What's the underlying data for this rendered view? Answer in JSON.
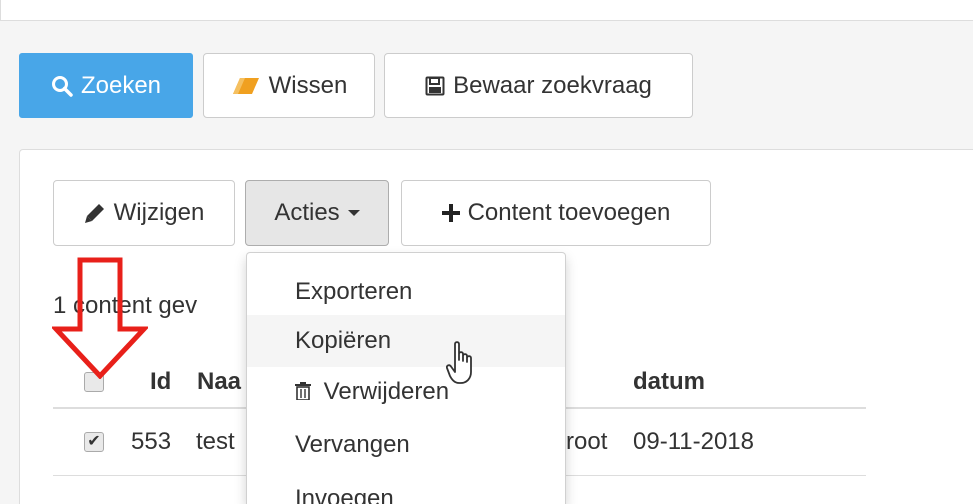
{
  "search_bar": {
    "search_label": "Zoeken",
    "clear_label": "Wissen",
    "save_query_label": "Bewaar zoekvraag"
  },
  "toolbar": {
    "edit_label": "Wijzigen",
    "actions_label": "Acties",
    "add_content_label": "Content toevoegen"
  },
  "results": {
    "count_text": "1 content gev"
  },
  "table": {
    "columns": {
      "id": "Id",
      "name": "Naa",
      "date": "datum"
    },
    "rows": [
      {
        "checked": true,
        "id": "553",
        "name": "test",
        "owner_partial": "root",
        "date": "09-11-2018"
      }
    ]
  },
  "actions_menu": {
    "items": [
      {
        "label": "Exporteren"
      },
      {
        "label": "Kopiëren",
        "hovered": true
      },
      {
        "label": "Verwijderen",
        "icon": "trash-icon"
      },
      {
        "label": "Vervangen"
      },
      {
        "label": "Invoegen"
      }
    ]
  },
  "colors": {
    "primary": "#48a6e8",
    "annotation_arrow": "#e8201a"
  }
}
